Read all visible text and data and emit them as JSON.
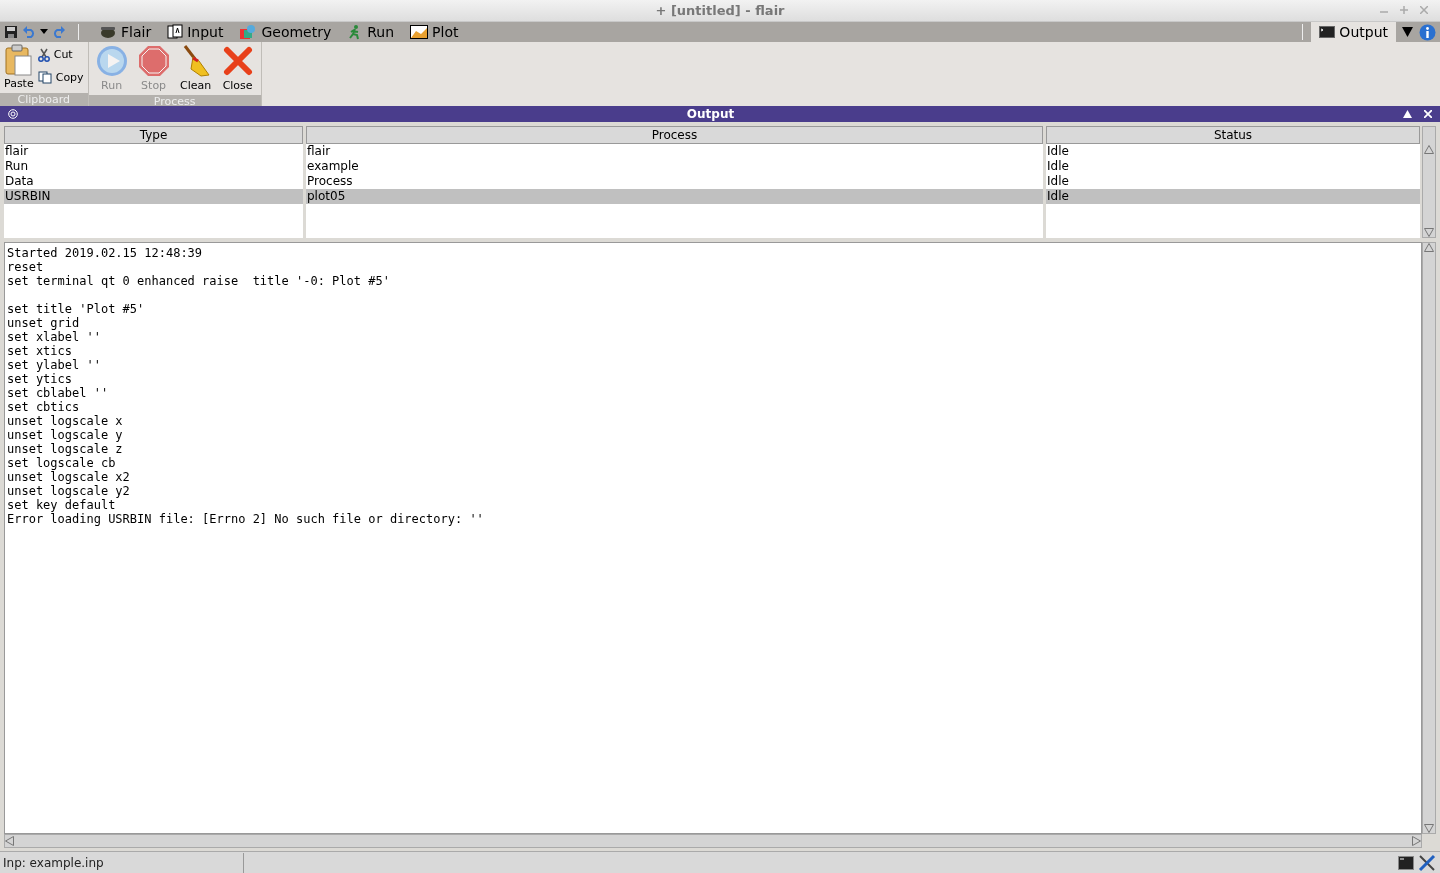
{
  "window": {
    "title": "+ [untitled] - flair"
  },
  "menu_tabs": [
    {
      "label": "Flair",
      "kind": "pot",
      "selected": false
    },
    {
      "label": "Input",
      "kind": "cards",
      "selected": false
    },
    {
      "label": "Geometry",
      "kind": "geometry",
      "selected": false
    },
    {
      "label": "Run",
      "kind": "runner",
      "selected": false
    },
    {
      "label": "Plot",
      "kind": "plot",
      "selected": false
    }
  ],
  "right_tab": {
    "label": "Output",
    "selected": true
  },
  "ribbon": {
    "groups": [
      {
        "label": "Clipboard",
        "kind": "clipboard",
        "buttons": [
          {
            "label": "Paste",
            "kind": "paste",
            "disabled": false
          },
          {
            "label": "Cut",
            "kind": "cut",
            "disabled": false
          },
          {
            "label": "Copy",
            "kind": "copy",
            "disabled": false
          }
        ]
      },
      {
        "label": "Process",
        "kind": "process",
        "buttons": [
          {
            "label": "Run",
            "kind": "run",
            "disabled": true
          },
          {
            "label": "Stop",
            "kind": "stop",
            "disabled": true
          },
          {
            "label": "Clean",
            "kind": "clean",
            "disabled": false
          },
          {
            "label": "Close",
            "kind": "close",
            "disabled": false
          }
        ]
      }
    ]
  },
  "panel": {
    "title": "Output"
  },
  "table": {
    "columns": [
      "Type",
      "Process",
      "Status"
    ],
    "rows": [
      {
        "cells": [
          "flair",
          "flair",
          "Idle"
        ],
        "selected": false
      },
      {
        "cells": [
          "Run",
          "example",
          "Idle"
        ],
        "selected": false
      },
      {
        "cells": [
          "Data",
          "Process",
          "Idle"
        ],
        "selected": false
      },
      {
        "cells": [
          "USRBIN",
          "plot05",
          "Idle"
        ],
        "selected": true
      }
    ]
  },
  "log_text": "Started 2019.02.15 12:48:39\nreset\nset terminal qt 0 enhanced raise  title '-0: Plot #5'\n\nset title 'Plot #5'\nunset grid\nset xlabel ''\nset xtics\nset ylabel ''\nset ytics\nset cblabel ''\nset cbtics\nunset logscale x\nunset logscale y\nunset logscale z\nset logscale cb\nunset logscale x2\nunset logscale y2\nset key default\nError loading USRBIN file: [Errno 2] No such file or directory: ''",
  "status_bar": {
    "text": "Inp: example.inp"
  }
}
